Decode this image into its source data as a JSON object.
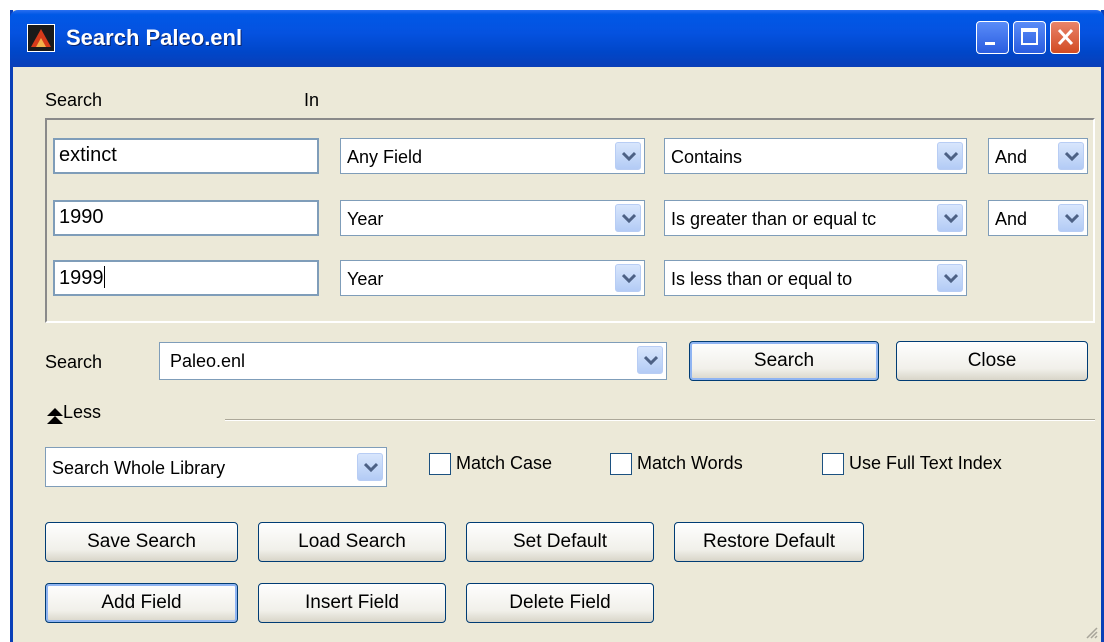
{
  "window": {
    "title": "Search Paleo.enl"
  },
  "labels": {
    "search": "Search",
    "in": "In",
    "search_in": "Search"
  },
  "criteria": [
    {
      "text": "extinct",
      "field": "Any Field",
      "operator": "Contains",
      "bool": "And"
    },
    {
      "text": "1990",
      "field": "Year",
      "operator": "Is greater than or equal tc",
      "bool": "And"
    },
    {
      "text": "1999",
      "field": "Year",
      "operator": "Is less than or equal to"
    }
  ],
  "search_library": "Paleo.enl",
  "buttons": {
    "search": "Search",
    "close": "Close",
    "save_search": "Save Search",
    "load_search": "Load Search",
    "set_default": "Set Default",
    "restore_default": "Restore Default",
    "add_field": "Add Field",
    "insert_field": "Insert Field",
    "delete_field": "Delete Field"
  },
  "less_toggle": "Less",
  "scope": "Search Whole Library",
  "options": {
    "match_case": "Match Case",
    "match_words": "Match Words",
    "full_text": "Use Full Text Index"
  },
  "colors": {
    "titlebar": "#0058e6",
    "window_bg": "#ece9d8",
    "close_button": "#d24b22"
  }
}
